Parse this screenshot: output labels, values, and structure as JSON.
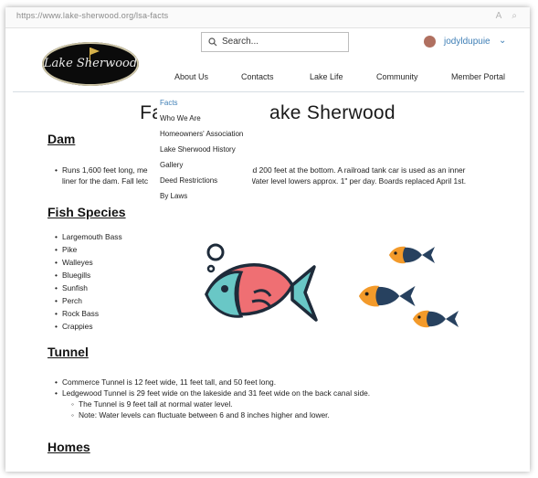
{
  "browser": {
    "url": "https://www.lake-sherwood.org/lsa-facts"
  },
  "header": {
    "logo_text": "Lake Sherwood",
    "search_placeholder": "Search...",
    "username": "jodyldupuie"
  },
  "nav": {
    "items": [
      "About Us",
      "Contacts",
      "Lake Life",
      "Community",
      "Member Portal"
    ]
  },
  "dropdown": {
    "items": [
      "Facts",
      "Who We Are",
      "Homeowners' Association",
      "Lake Sherwood History",
      "Gallery",
      "Deed Restrictions",
      "By Laws"
    ]
  },
  "page": {
    "title_left": "Fac",
    "title_right": "ake Sherwood",
    "sections": {
      "dam": {
        "heading": "Dam",
        "line1_left": "Runs 1,600 feet long, me",
        "line1_right": "nd 200 feet at the bottom. A railroad tank car is used as an inner",
        "line2_left": "liner for the dam. Fall letc",
        "line2_right": "Water level lowers approx. 1\" per day. Boards replaced April 1st."
      },
      "fish": {
        "heading": "Fish Species",
        "items": [
          "Largemouth Bass",
          "Pike",
          "Walleyes",
          "Bluegills",
          "Sunfish",
          "Perch",
          "Rock Bass",
          "Crappies"
        ]
      },
      "tunnel": {
        "heading": "Tunnel",
        "items": [
          "Commerce Tunnel is 12 feet wide, 11 feet tall, and 50 feet long.",
          "Ledgewood Tunnel is 29 feet wide on the lakeside and 31 feet wide on the back canal side."
        ],
        "subitems": [
          "The Tunnel is 9 feet tall at normal water level.",
          "Note: Water levels can fluctuate between 6 and 8 inches higher and lower."
        ]
      },
      "homes": {
        "heading": "Homes"
      }
    }
  },
  "colors": {
    "link": "#3f7fb6",
    "fish_red": "#ef6f73",
    "fish_teal": "#69c7c6",
    "fish_orange": "#f39a2a",
    "fish_navy": "#27415f"
  }
}
